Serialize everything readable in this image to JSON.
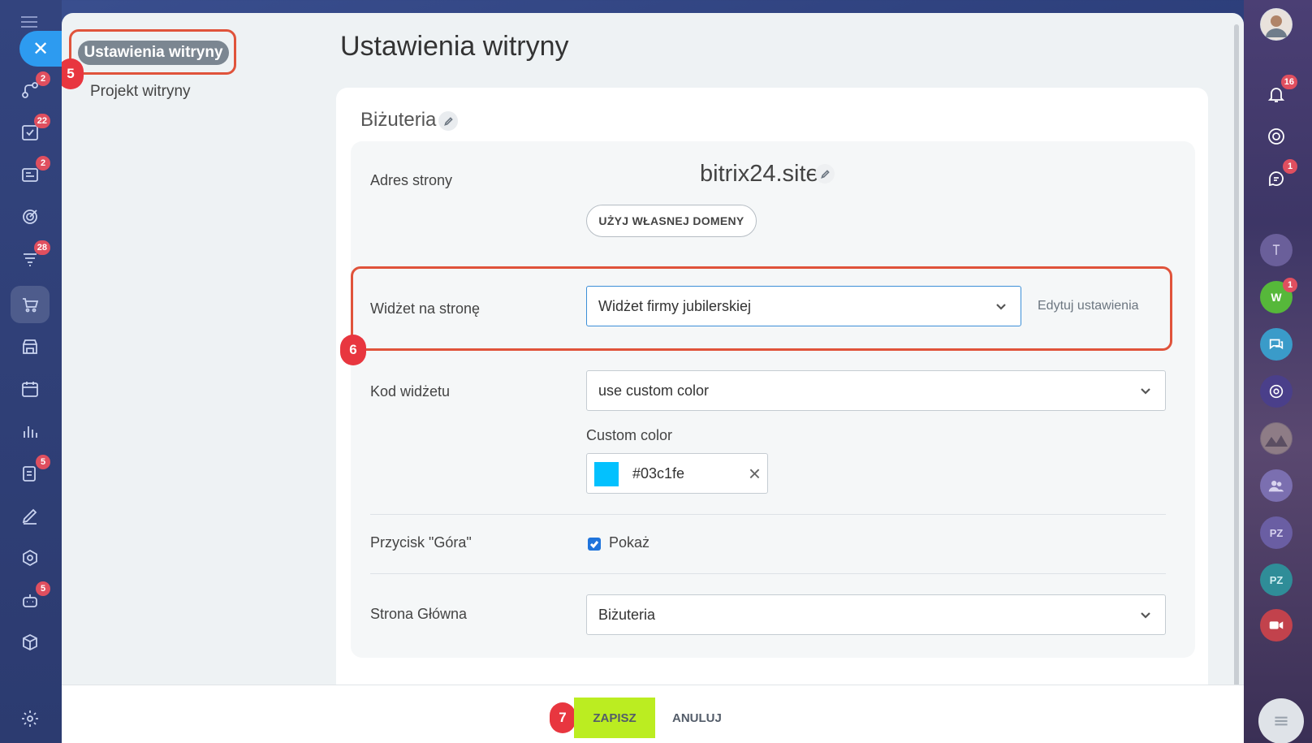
{
  "left_rail": {
    "badges": {
      "pipelines": "2",
      "tasks": "22",
      "crm": "2",
      "funnels": "28",
      "docs": "5",
      "bot": "5"
    }
  },
  "right_rail": {
    "notifications_badge": "16",
    "chat_badge": "1",
    "w_avatar_letter": "W",
    "w_badge": "1",
    "pz1": "PZ",
    "pz2": "PZ"
  },
  "side_nav": {
    "active_item": "Ustawienia witryny",
    "item_project": "Projekt witryny"
  },
  "annotations": {
    "a5": "5",
    "a6": "6",
    "a7": "7"
  },
  "page_title": "Ustawienia witryny",
  "card": {
    "site_name": "Biżuteria",
    "fields": {
      "address_label": "Adres strony",
      "domain": "bitrix24.site",
      "own_domain_button": "UŻYJ WŁASNEJ DOMENY",
      "widget_label": "Widżet na stronę",
      "widget_value": "Widżet firmy jubilerskiej",
      "edit_settings_link": "Edytuj ustawienia",
      "widget_code_label": "Kod widżetu",
      "widget_code_value": "use custom color",
      "custom_color_label": "Custom color",
      "custom_color_value": "#03c1fe",
      "top_button_label": "Przycisk \"Góra\"",
      "top_button_checkbox_label": "Pokaż",
      "top_button_checked": true,
      "home_page_label": "Strona Główna",
      "home_page_value": "Biżuteria"
    }
  },
  "colors": {
    "swatch": "#03c1fe",
    "save_button": "#bbed21",
    "annotation": "#e8363f",
    "accent_blue": "#2d9bf0"
  },
  "footer": {
    "save_label": "ZAPISZ",
    "cancel_label": "ANULUJ"
  }
}
